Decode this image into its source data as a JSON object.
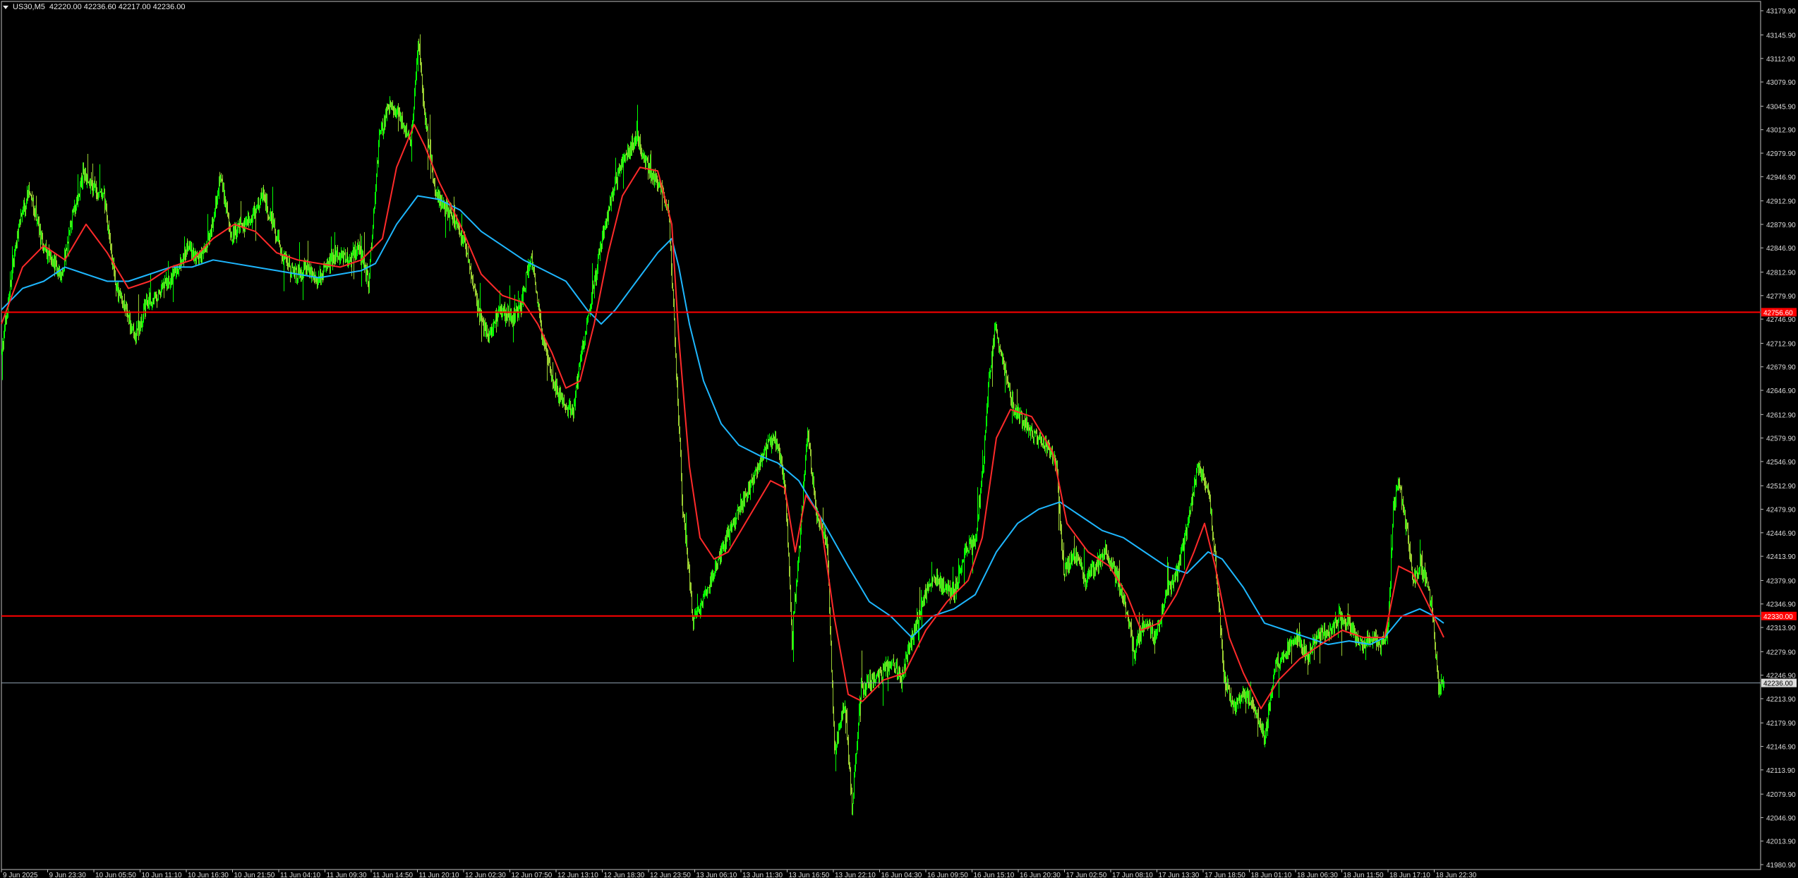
{
  "header": {
    "symbol": "US30,M5",
    "ohlc": "42220.00 42236.60 42217.00 42236.00"
  },
  "colors": {
    "background": "#000000",
    "frame": "#c0c0c0",
    "text": "#dcdcdc",
    "candle_up": "#00ff00",
    "candle_down": "#9acd32",
    "ma_fast": "#ff2a2a",
    "ma_slow": "#1eb7ff",
    "level_line": "#ff0000",
    "bid_line": "#8fa0b0",
    "label_bg": "#ff0000"
  },
  "chart_data": {
    "type": "candlestick",
    "symbol": "US30",
    "timeframe": "M5",
    "y_ticks": [
      "43179.90",
      "43145.90",
      "43112.90",
      "43079.90",
      "43045.90",
      "43012.90",
      "42979.90",
      "42946.90",
      "42912.90",
      "42879.90",
      "42846.90",
      "42812.90",
      "42779.90",
      "42746.90",
      "42712.90",
      "42679.90",
      "42646.90",
      "42612.90",
      "42579.90",
      "42546.90",
      "42512.90",
      "42479.90",
      "42446.90",
      "42413.90",
      "42379.90",
      "42346.90",
      "42313.90",
      "42279.90",
      "42246.90",
      "42213.90",
      "42179.90",
      "42146.90",
      "42113.90",
      "42079.90",
      "42046.90",
      "42013.90",
      "41980.90"
    ],
    "ylim": [
      41974,
      43193
    ],
    "x_ticks": [
      "9 Jun 2025",
      "9 Jun 23:30",
      "10 Jun 05:50",
      "10 Jun 11:10",
      "10 Jun 16:30",
      "10 Jun 21:50",
      "11 Jun 04:10",
      "11 Jun 09:30",
      "11 Jun 14:50",
      "11 Jun 20:10",
      "12 Jun 02:30",
      "12 Jun 07:50",
      "12 Jun 13:10",
      "12 Jun 18:30",
      "12 Jun 23:50",
      "13 Jun 06:10",
      "13 Jun 11:30",
      "13 Jun 16:50",
      "13 Jun 22:10",
      "16 Jun 04:30",
      "16 Jun 09:50",
      "16 Jun 15:10",
      "16 Jun 20:30",
      "17 Jun 02:50",
      "17 Jun 08:10",
      "17 Jun 13:30",
      "17 Jun 18:50",
      "18 Jun 01:10",
      "18 Jun 06:30",
      "18 Jun 11:50",
      "18 Jun 17:10",
      "18 Jun 22:30"
    ],
    "price_path": [
      [
        0,
        42700
      ],
      [
        10,
        42780
      ],
      [
        25,
        42880
      ],
      [
        40,
        42930
      ],
      [
        55,
        42860
      ],
      [
        70,
        42830
      ],
      [
        85,
        42810
      ],
      [
        100,
        42890
      ],
      [
        115,
        42950
      ],
      [
        130,
        42930
      ],
      [
        145,
        42920
      ],
      [
        160,
        42800
      ],
      [
        175,
        42760
      ],
      [
        190,
        42720
      ],
      [
        205,
        42770
      ],
      [
        220,
        42780
      ],
      [
        235,
        42800
      ],
      [
        250,
        42820
      ],
      [
        265,
        42850
      ],
      [
        280,
        42830
      ],
      [
        295,
        42860
      ],
      [
        310,
        42950
      ],
      [
        325,
        42860
      ],
      [
        340,
        42880
      ],
      [
        355,
        42890
      ],
      [
        370,
        42920
      ],
      [
        385,
        42880
      ],
      [
        400,
        42830
      ],
      [
        415,
        42810
      ],
      [
        430,
        42820
      ],
      [
        445,
        42800
      ],
      [
        460,
        42820
      ],
      [
        475,
        42840
      ],
      [
        490,
        42830
      ],
      [
        505,
        42850
      ],
      [
        520,
        42800
      ],
      [
        535,
        43000
      ],
      [
        550,
        43050
      ],
      [
        565,
        43030
      ],
      [
        580,
        42990
      ],
      [
        590,
        43140
      ],
      [
        600,
        43030
      ],
      [
        615,
        42920
      ],
      [
        630,
        42900
      ],
      [
        645,
        42880
      ],
      [
        660,
        42840
      ],
      [
        675,
        42760
      ],
      [
        690,
        42720
      ],
      [
        705,
        42760
      ],
      [
        720,
        42750
      ],
      [
        735,
        42760
      ],
      [
        750,
        42840
      ],
      [
        765,
        42730
      ],
      [
        780,
        42660
      ],
      [
        795,
        42630
      ],
      [
        810,
        42620
      ],
      [
        825,
        42720
      ],
      [
        840,
        42800
      ],
      [
        855,
        42880
      ],
      [
        870,
        42940
      ],
      [
        885,
        42980
      ],
      [
        900,
        43000
      ],
      [
        915,
        42960
      ],
      [
        930,
        42940
      ],
      [
        945,
        42900
      ],
      [
        955,
        42700
      ],
      [
        965,
        42480
      ],
      [
        980,
        42320
      ],
      [
        990,
        42340
      ],
      [
        1005,
        42380
      ],
      [
        1020,
        42420
      ],
      [
        1035,
        42460
      ],
      [
        1050,
        42490
      ],
      [
        1065,
        42520
      ],
      [
        1080,
        42560
      ],
      [
        1095,
        42580
      ],
      [
        1110,
        42520
      ],
      [
        1120,
        42300
      ],
      [
        1130,
        42420
      ],
      [
        1142,
        42590
      ],
      [
        1155,
        42470
      ],
      [
        1170,
        42430
      ],
      [
        1180,
        42140
      ],
      [
        1195,
        42210
      ],
      [
        1205,
        42060
      ],
      [
        1218,
        42230
      ],
      [
        1232,
        42240
      ],
      [
        1248,
        42250
      ],
      [
        1262,
        42270
      ],
      [
        1275,
        42240
      ],
      [
        1290,
        42300
      ],
      [
        1305,
        42350
      ],
      [
        1320,
        42390
      ],
      [
        1335,
        42370
      ],
      [
        1350,
        42360
      ],
      [
        1365,
        42420
      ],
      [
        1380,
        42440
      ],
      [
        1390,
        42530
      ],
      [
        1398,
        42650
      ],
      [
        1408,
        42740
      ],
      [
        1420,
        42680
      ],
      [
        1435,
        42620
      ],
      [
        1450,
        42600
      ],
      [
        1465,
        42580
      ],
      [
        1480,
        42570
      ],
      [
        1495,
        42540
      ],
      [
        1505,
        42390
      ],
      [
        1520,
        42420
      ],
      [
        1535,
        42380
      ],
      [
        1550,
        42400
      ],
      [
        1565,
        42420
      ],
      [
        1580,
        42390
      ],
      [
        1595,
        42330
      ],
      [
        1605,
        42280
      ],
      [
        1620,
        42320
      ],
      [
        1635,
        42300
      ],
      [
        1650,
        42360
      ],
      [
        1665,
        42390
      ],
      [
        1680,
        42450
      ],
      [
        1695,
        42540
      ],
      [
        1710,
        42510
      ],
      [
        1720,
        42410
      ],
      [
        1732,
        42250
      ],
      [
        1745,
        42200
      ],
      [
        1760,
        42220
      ],
      [
        1775,
        42200
      ],
      [
        1790,
        42160
      ],
      [
        1805,
        42260
      ],
      [
        1820,
        42280
      ],
      [
        1835,
        42300
      ],
      [
        1850,
        42270
      ],
      [
        1865,
        42310
      ],
      [
        1880,
        42300
      ],
      [
        1895,
        42330
      ],
      [
        1910,
        42320
      ],
      [
        1925,
        42290
      ],
      [
        1940,
        42300
      ],
      [
        1955,
        42290
      ],
      [
        1965,
        42310
      ],
      [
        1972,
        42480
      ],
      [
        1980,
        42520
      ],
      [
        1990,
        42460
      ],
      [
        2000,
        42380
      ],
      [
        2010,
        42400
      ],
      [
        2020,
        42380
      ],
      [
        2028,
        42330
      ],
      [
        2036,
        42230
      ],
      [
        2044,
        42236
      ]
    ],
    "ma_fast": [
      [
        0,
        42740
      ],
      [
        30,
        42820
      ],
      [
        60,
        42850
      ],
      [
        90,
        42830
      ],
      [
        120,
        42880
      ],
      [
        150,
        42840
      ],
      [
        180,
        42790
      ],
      [
        210,
        42800
      ],
      [
        240,
        42820
      ],
      [
        270,
        42830
      ],
      [
        300,
        42860
      ],
      [
        330,
        42880
      ],
      [
        360,
        42870
      ],
      [
        390,
        42840
      ],
      [
        420,
        42830
      ],
      [
        450,
        42825
      ],
      [
        480,
        42820
      ],
      [
        510,
        42830
      ],
      [
        540,
        42860
      ],
      [
        560,
        42960
      ],
      [
        585,
        43020
      ],
      [
        600,
        42990
      ],
      [
        620,
        42940
      ],
      [
        650,
        42880
      ],
      [
        680,
        42810
      ],
      [
        710,
        42780
      ],
      [
        740,
        42770
      ],
      [
        760,
        42740
      ],
      [
        780,
        42700
      ],
      [
        800,
        42650
      ],
      [
        820,
        42660
      ],
      [
        840,
        42740
      ],
      [
        860,
        42840
      ],
      [
        880,
        42920
      ],
      [
        905,
        42960
      ],
      [
        930,
        42955
      ],
      [
        950,
        42880
      ],
      [
        960,
        42720
      ],
      [
        975,
        42540
      ],
      [
        990,
        42440
      ],
      [
        1010,
        42410
      ],
      [
        1030,
        42420
      ],
      [
        1060,
        42470
      ],
      [
        1090,
        42520
      ],
      [
        1110,
        42510
      ],
      [
        1125,
        42420
      ],
      [
        1140,
        42500
      ],
      [
        1160,
        42470
      ],
      [
        1180,
        42330
      ],
      [
        1200,
        42220
      ],
      [
        1220,
        42210
      ],
      [
        1250,
        42240
      ],
      [
        1280,
        42250
      ],
      [
        1310,
        42310
      ],
      [
        1340,
        42350
      ],
      [
        1370,
        42380
      ],
      [
        1390,
        42440
      ],
      [
        1410,
        42580
      ],
      [
        1430,
        42620
      ],
      [
        1460,
        42610
      ],
      [
        1490,
        42560
      ],
      [
        1510,
        42460
      ],
      [
        1540,
        42420
      ],
      [
        1570,
        42400
      ],
      [
        1595,
        42360
      ],
      [
        1615,
        42310
      ],
      [
        1640,
        42320
      ],
      [
        1665,
        42360
      ],
      [
        1690,
        42420
      ],
      [
        1705,
        42460
      ],
      [
        1720,
        42400
      ],
      [
        1740,
        42300
      ],
      [
        1760,
        42250
      ],
      [
        1785,
        42200
      ],
      [
        1810,
        42240
      ],
      [
        1840,
        42270
      ],
      [
        1870,
        42290
      ],
      [
        1900,
        42310
      ],
      [
        1930,
        42300
      ],
      [
        1960,
        42300
      ],
      [
        1980,
        42400
      ],
      [
        2000,
        42390
      ],
      [
        2020,
        42350
      ],
      [
        2044,
        42300
      ]
    ],
    "ma_slow": [
      [
        0,
        42760
      ],
      [
        30,
        42790
      ],
      [
        60,
        42800
      ],
      [
        90,
        42820
      ],
      [
        120,
        42810
      ],
      [
        150,
        42800
      ],
      [
        180,
        42800
      ],
      [
        210,
        42810
      ],
      [
        240,
        42820
      ],
      [
        270,
        42820
      ],
      [
        300,
        42830
      ],
      [
        330,
        42825
      ],
      [
        360,
        42820
      ],
      [
        390,
        42815
      ],
      [
        420,
        42810
      ],
      [
        450,
        42805
      ],
      [
        480,
        42810
      ],
      [
        510,
        42815
      ],
      [
        530,
        42825
      ],
      [
        560,
        42880
      ],
      [
        590,
        42920
      ],
      [
        620,
        42915
      ],
      [
        650,
        42900
      ],
      [
        680,
        42870
      ],
      [
        710,
        42850
      ],
      [
        740,
        42830
      ],
      [
        770,
        42815
      ],
      [
        800,
        42800
      ],
      [
        830,
        42760
      ],
      [
        850,
        42740
      ],
      [
        870,
        42760
      ],
      [
        900,
        42800
      ],
      [
        930,
        42840
      ],
      [
        950,
        42860
      ],
      [
        960,
        42820
      ],
      [
        975,
        42740
      ],
      [
        995,
        42660
      ],
      [
        1020,
        42600
      ],
      [
        1045,
        42570
      ],
      [
        1075,
        42555
      ],
      [
        1100,
        42545
      ],
      [
        1130,
        42520
      ],
      [
        1160,
        42470
      ],
      [
        1200,
        42400
      ],
      [
        1230,
        42350
      ],
      [
        1260,
        42330
      ],
      [
        1290,
        42300
      ],
      [
        1320,
        42330
      ],
      [
        1350,
        42340
      ],
      [
        1380,
        42360
      ],
      [
        1410,
        42420
      ],
      [
        1440,
        42460
      ],
      [
        1470,
        42480
      ],
      [
        1500,
        42490
      ],
      [
        1530,
        42470
      ],
      [
        1560,
        42450
      ],
      [
        1590,
        42440
      ],
      [
        1620,
        42420
      ],
      [
        1650,
        42400
      ],
      [
        1680,
        42390
      ],
      [
        1710,
        42420
      ],
      [
        1730,
        42410
      ],
      [
        1760,
        42370
      ],
      [
        1790,
        42320
      ],
      [
        1820,
        42310
      ],
      [
        1850,
        42300
      ],
      [
        1880,
        42290
      ],
      [
        1910,
        42295
      ],
      [
        1940,
        42290
      ],
      [
        1960,
        42300
      ],
      [
        1985,
        42330
      ],
      [
        2010,
        42340
      ],
      [
        2030,
        42330
      ],
      [
        2044,
        42320
      ]
    ],
    "horizontal_levels": [
      {
        "price": 42756.6,
        "label": "42756.60"
      },
      {
        "price": 42330.0,
        "label": "42330.00"
      }
    ],
    "current_price": {
      "price": 42236.0,
      "label": "42236.00"
    }
  }
}
